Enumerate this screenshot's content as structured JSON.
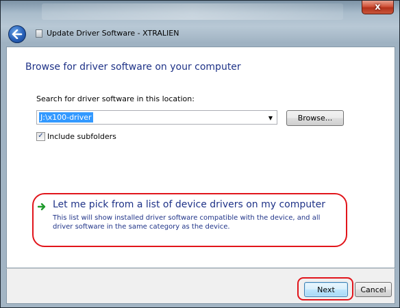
{
  "window": {
    "title": "Update Driver Software - XTRALIEN",
    "close_glyph": "x",
    "back_icon": "back-arrow-icon",
    "wizard_icon": "document-icon"
  },
  "main": {
    "heading": "Browse for driver software on your computer",
    "search_label": "Search for driver software in this location:",
    "path_value": "J:\\x100-driver",
    "combo_arrow_glyph": "▼",
    "browse_label": "Browse...",
    "include_subfolders": {
      "label": "Include subfolders",
      "checked": true,
      "check_glyph": "✓"
    },
    "pick_option": {
      "icon": "green-arrow-icon",
      "title": "Let me pick from a list of device drivers on my computer",
      "description": "This list will show installed driver software compatible with the device, and all driver software in the same category as the device."
    }
  },
  "footer": {
    "next_label": "Next",
    "cancel_label": "Cancel"
  },
  "colors": {
    "link_blue": "#1e3287",
    "highlight_red": "#e1141a",
    "selection_blue": "#3399ff"
  }
}
